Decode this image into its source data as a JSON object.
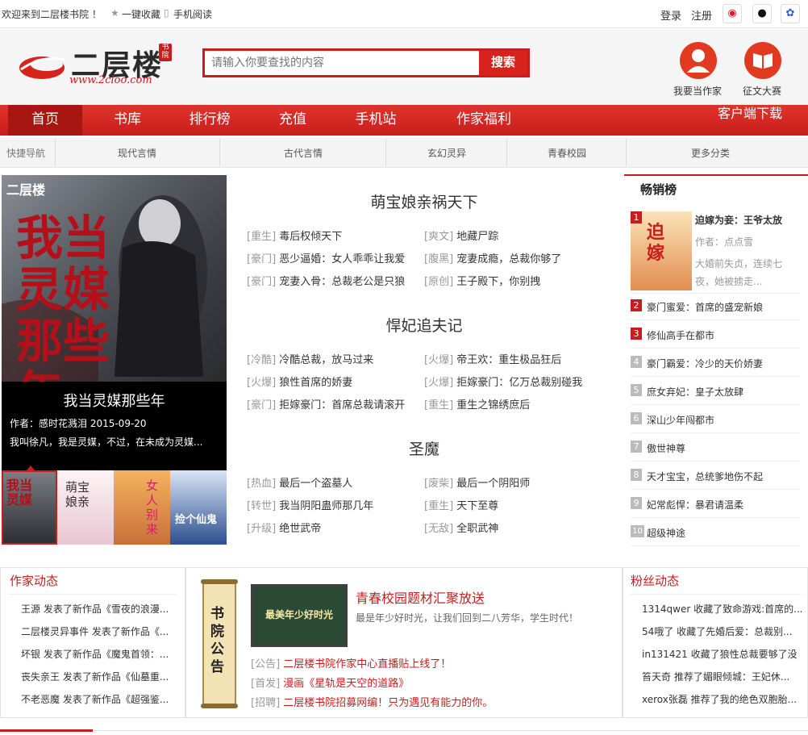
{
  "topbar": {
    "welcome": "欢迎来到二层楼书院 ！",
    "bookmark": "一键收藏",
    "mobile": "手机阅读",
    "login": "登录",
    "register": "注册"
  },
  "logo": {
    "text": "二层楼",
    "url": "www.2cloo.com",
    "seal": "书院"
  },
  "search": {
    "placeholder": "请输入你要查找的内容",
    "button": "搜索"
  },
  "header_actions": [
    {
      "label": "我要当作家",
      "icon": "writer-icon"
    },
    {
      "label": "征文大赛",
      "icon": "book-icon"
    }
  ],
  "nav": {
    "items": [
      "首页",
      "书库",
      "排行榜",
      "充值",
      "手机站",
      "作家福利"
    ],
    "client_download": "客户端下载"
  },
  "quicknav": {
    "label": "快捷导航",
    "items": [
      "现代言情",
      "古代言情",
      "玄幻灵异",
      "青春校园",
      "更多分类"
    ]
  },
  "feature": {
    "cover_logo": "二层楼",
    "cover_title": "我当灵媒那些年",
    "title": "我当灵媒那些年",
    "author_line": "作者：感时花溅泪   2015-09-20",
    "desc": "我叫徐凡，我是灵媒，不过，在未成为灵媒..."
  },
  "sections": [
    {
      "title": "萌宝娘亲祸天下",
      "rows": [
        [
          {
            "tag": "[重生]",
            "title": "毒后权倾天下"
          },
          {
            "tag": "[爽文]",
            "title": "地藏尸踪"
          }
        ],
        [
          {
            "tag": "[豪门]",
            "title": "恶少逼婚：女人乖乖让我爱"
          },
          {
            "tag": "[腹黑]",
            "title": "宠妻成瘾，总裁你够了"
          }
        ],
        [
          {
            "tag": "[豪门]",
            "title": "宠妻入骨：总裁老公是只狼"
          },
          {
            "tag": "[原创]",
            "title": "王子殿下，你别拽"
          }
        ]
      ]
    },
    {
      "title": "悍妃追夫记",
      "rows": [
        [
          {
            "tag": "[冷酷]",
            "title": "冷酷总裁，放马过来"
          },
          {
            "tag": "[火爆]",
            "title": "帝王欢：重生极品狂后"
          }
        ],
        [
          {
            "tag": "[火爆]",
            "title": "狼性首席的娇妻"
          },
          {
            "tag": "[火爆]",
            "title": "拒嫁豪门：亿万总裁别碰我"
          }
        ],
        [
          {
            "tag": "[豪门]",
            "title": "拒嫁豪门：首席总裁请滚开"
          },
          {
            "tag": "[重生]",
            "title": "重生之锦绣庶后"
          }
        ]
      ]
    },
    {
      "title": "圣魔",
      "rows": [
        [
          {
            "tag": "[热血]",
            "title": "最后一个盗墓人"
          },
          {
            "tag": "[废柴]",
            "title": "最后一个阴阳师"
          }
        ],
        [
          {
            "tag": "[转世]",
            "title": "我当阴阳蛊师那几年"
          },
          {
            "tag": "[重生]",
            "title": "天下至尊"
          }
        ],
        [
          {
            "tag": "[升级]",
            "title": "绝世武帝"
          },
          {
            "tag": "[无敌]",
            "title": "全职武神"
          }
        ]
      ]
    }
  ],
  "ranking": {
    "title": "畅销榜",
    "top": {
      "num": "1",
      "title": "迫嫁为妾：王爷太放",
      "author": "作者：点点雪",
      "desc1": "大婚前失贞，连续七",
      "desc2": "夜，她被掳走..."
    },
    "items": [
      {
        "num": "2",
        "title": "豪门蜜爱：首席的盛宠新娘"
      },
      {
        "num": "3",
        "title": "修仙高手在都市"
      },
      {
        "num": "4",
        "title": "豪门霸爱：冷少的天价娇妻"
      },
      {
        "num": "5",
        "title": "庶女弃妃：皇子太放肆"
      },
      {
        "num": "6",
        "title": "深山少年闯都市"
      },
      {
        "num": "7",
        "title": "傲世神尊"
      },
      {
        "num": "8",
        "title": "天才宝宝，总统爹地伤不起"
      },
      {
        "num": "9",
        "title": "妃常彪悍：暴君请温柔"
      },
      {
        "num": "10",
        "title": "超级神途"
      }
    ]
  },
  "writer_news": {
    "title": "作家动态",
    "items": [
      "王源 发表了新作品《雪夜的浪漫...",
      "二层楼灵异事件 发表了新作品《...",
      "坏银 发表了新作品《魔鬼首领：...",
      "丧失亲王 发表了新作品《仙墓重...",
      "不老恶魔 发表了新作品《超强鉴..."
    ]
  },
  "notice": {
    "scroll_text": "书院公告",
    "board_title": "青春校园题材汇聚放送",
    "board_img_text": "最美年少好时光",
    "board_desc": "最是年少好时光，让我们回到二八芳华，学生时代！",
    "items": [
      {
        "tag": "[公告]",
        "text": "二层楼书院作家中心直播贴上线了！"
      },
      {
        "tag": "[首发]",
        "text": "漫画《星轨是天空的道路》"
      },
      {
        "tag": "[招聘]",
        "text": "二层楼书院招募网编！只为遇见有能力的你。"
      }
    ]
  },
  "fan_news": {
    "title": "粉丝动态",
    "items": [
      "1314qwer 收藏了致命游戏:首席的...",
      "54哦了 收藏了先婚后爱：总裁别...",
      "in131421 收藏了狼性总裁要够了没",
      "笞天奇 推荐了媚眼倾城：王妃休...",
      "xerox张磊 推荐了我的绝色双胞胎..."
    ]
  },
  "colors": {
    "brand_red": "#c81d1d",
    "nav_red": "#d4261d"
  }
}
